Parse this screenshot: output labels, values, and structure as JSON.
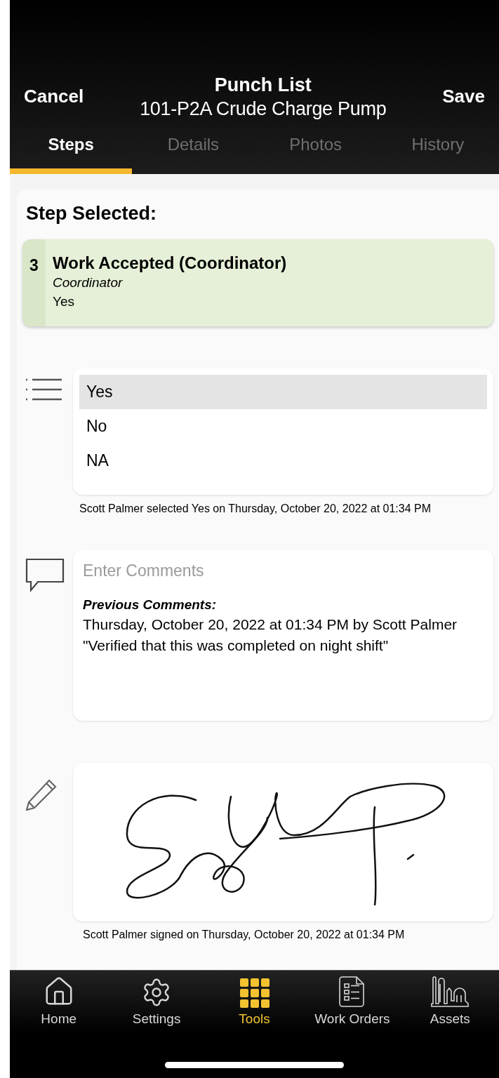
{
  "header": {
    "cancel": "Cancel",
    "title": "Punch List",
    "subtitle": "101-P2A Crude Charge Pump",
    "save": "Save"
  },
  "tabs": [
    {
      "label": "Steps",
      "selected": true
    },
    {
      "label": "Details",
      "selected": false
    },
    {
      "label": "Photos",
      "selected": false
    },
    {
      "label": "History",
      "selected": false
    }
  ],
  "step_selected": {
    "heading": "Step Selected:",
    "number": "3",
    "name": "Work Accepted (Coordinator)",
    "role": "Coordinator",
    "answer": "Yes"
  },
  "choice": {
    "options": [
      {
        "label": "Yes",
        "selected": true
      },
      {
        "label": "No",
        "selected": false
      },
      {
        "label": "NA",
        "selected": false
      }
    ],
    "note": "Scott Palmer selected Yes on Thursday, October 20, 2022 at 01:34 PM"
  },
  "comments": {
    "placeholder": "Enter Comments",
    "previous_heading": "Previous Comments:",
    "previous_date": "Thursday, October 20, 2022 at 01:34 PM by Scott Palmer",
    "previous_text": "\"Verified that this was completed on night shift\""
  },
  "signature": {
    "note": "Scott Palmer signed on Thursday, October 20, 2022 at 01:34 PM"
  },
  "nav": [
    {
      "kind": "home",
      "label": "Home",
      "selected": false
    },
    {
      "kind": "settings",
      "label": "Settings",
      "selected": false
    },
    {
      "kind": "tools",
      "label": "Tools",
      "selected": true
    },
    {
      "kind": "work_orders",
      "label": "Work Orders",
      "selected": false
    },
    {
      "kind": "assets",
      "label": "Assets",
      "selected": false
    }
  ]
}
